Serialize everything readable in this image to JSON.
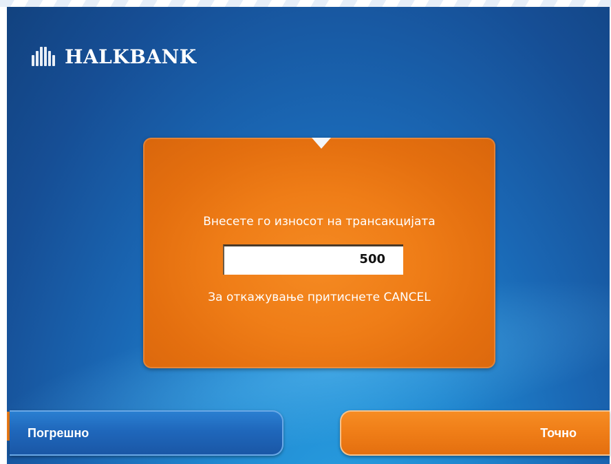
{
  "brand": {
    "name": "HALKBANK",
    "logo_icon": "halkbank-columns-logo-icon"
  },
  "dialog": {
    "prompt": "Внесете го износот на трансакцијата",
    "amount_value": "500",
    "cancel_hint": "За откажување притиснете CANCEL",
    "pointer_icon": "triangle-down-icon"
  },
  "buttons": {
    "wrong_label": "Погрешно",
    "correct_label": "Точно"
  },
  "colors": {
    "background_blue": "#1a67b4",
    "dialog_orange": "#ef7d17",
    "button_blue": "#1f67bb",
    "button_orange": "#ef7d17"
  }
}
